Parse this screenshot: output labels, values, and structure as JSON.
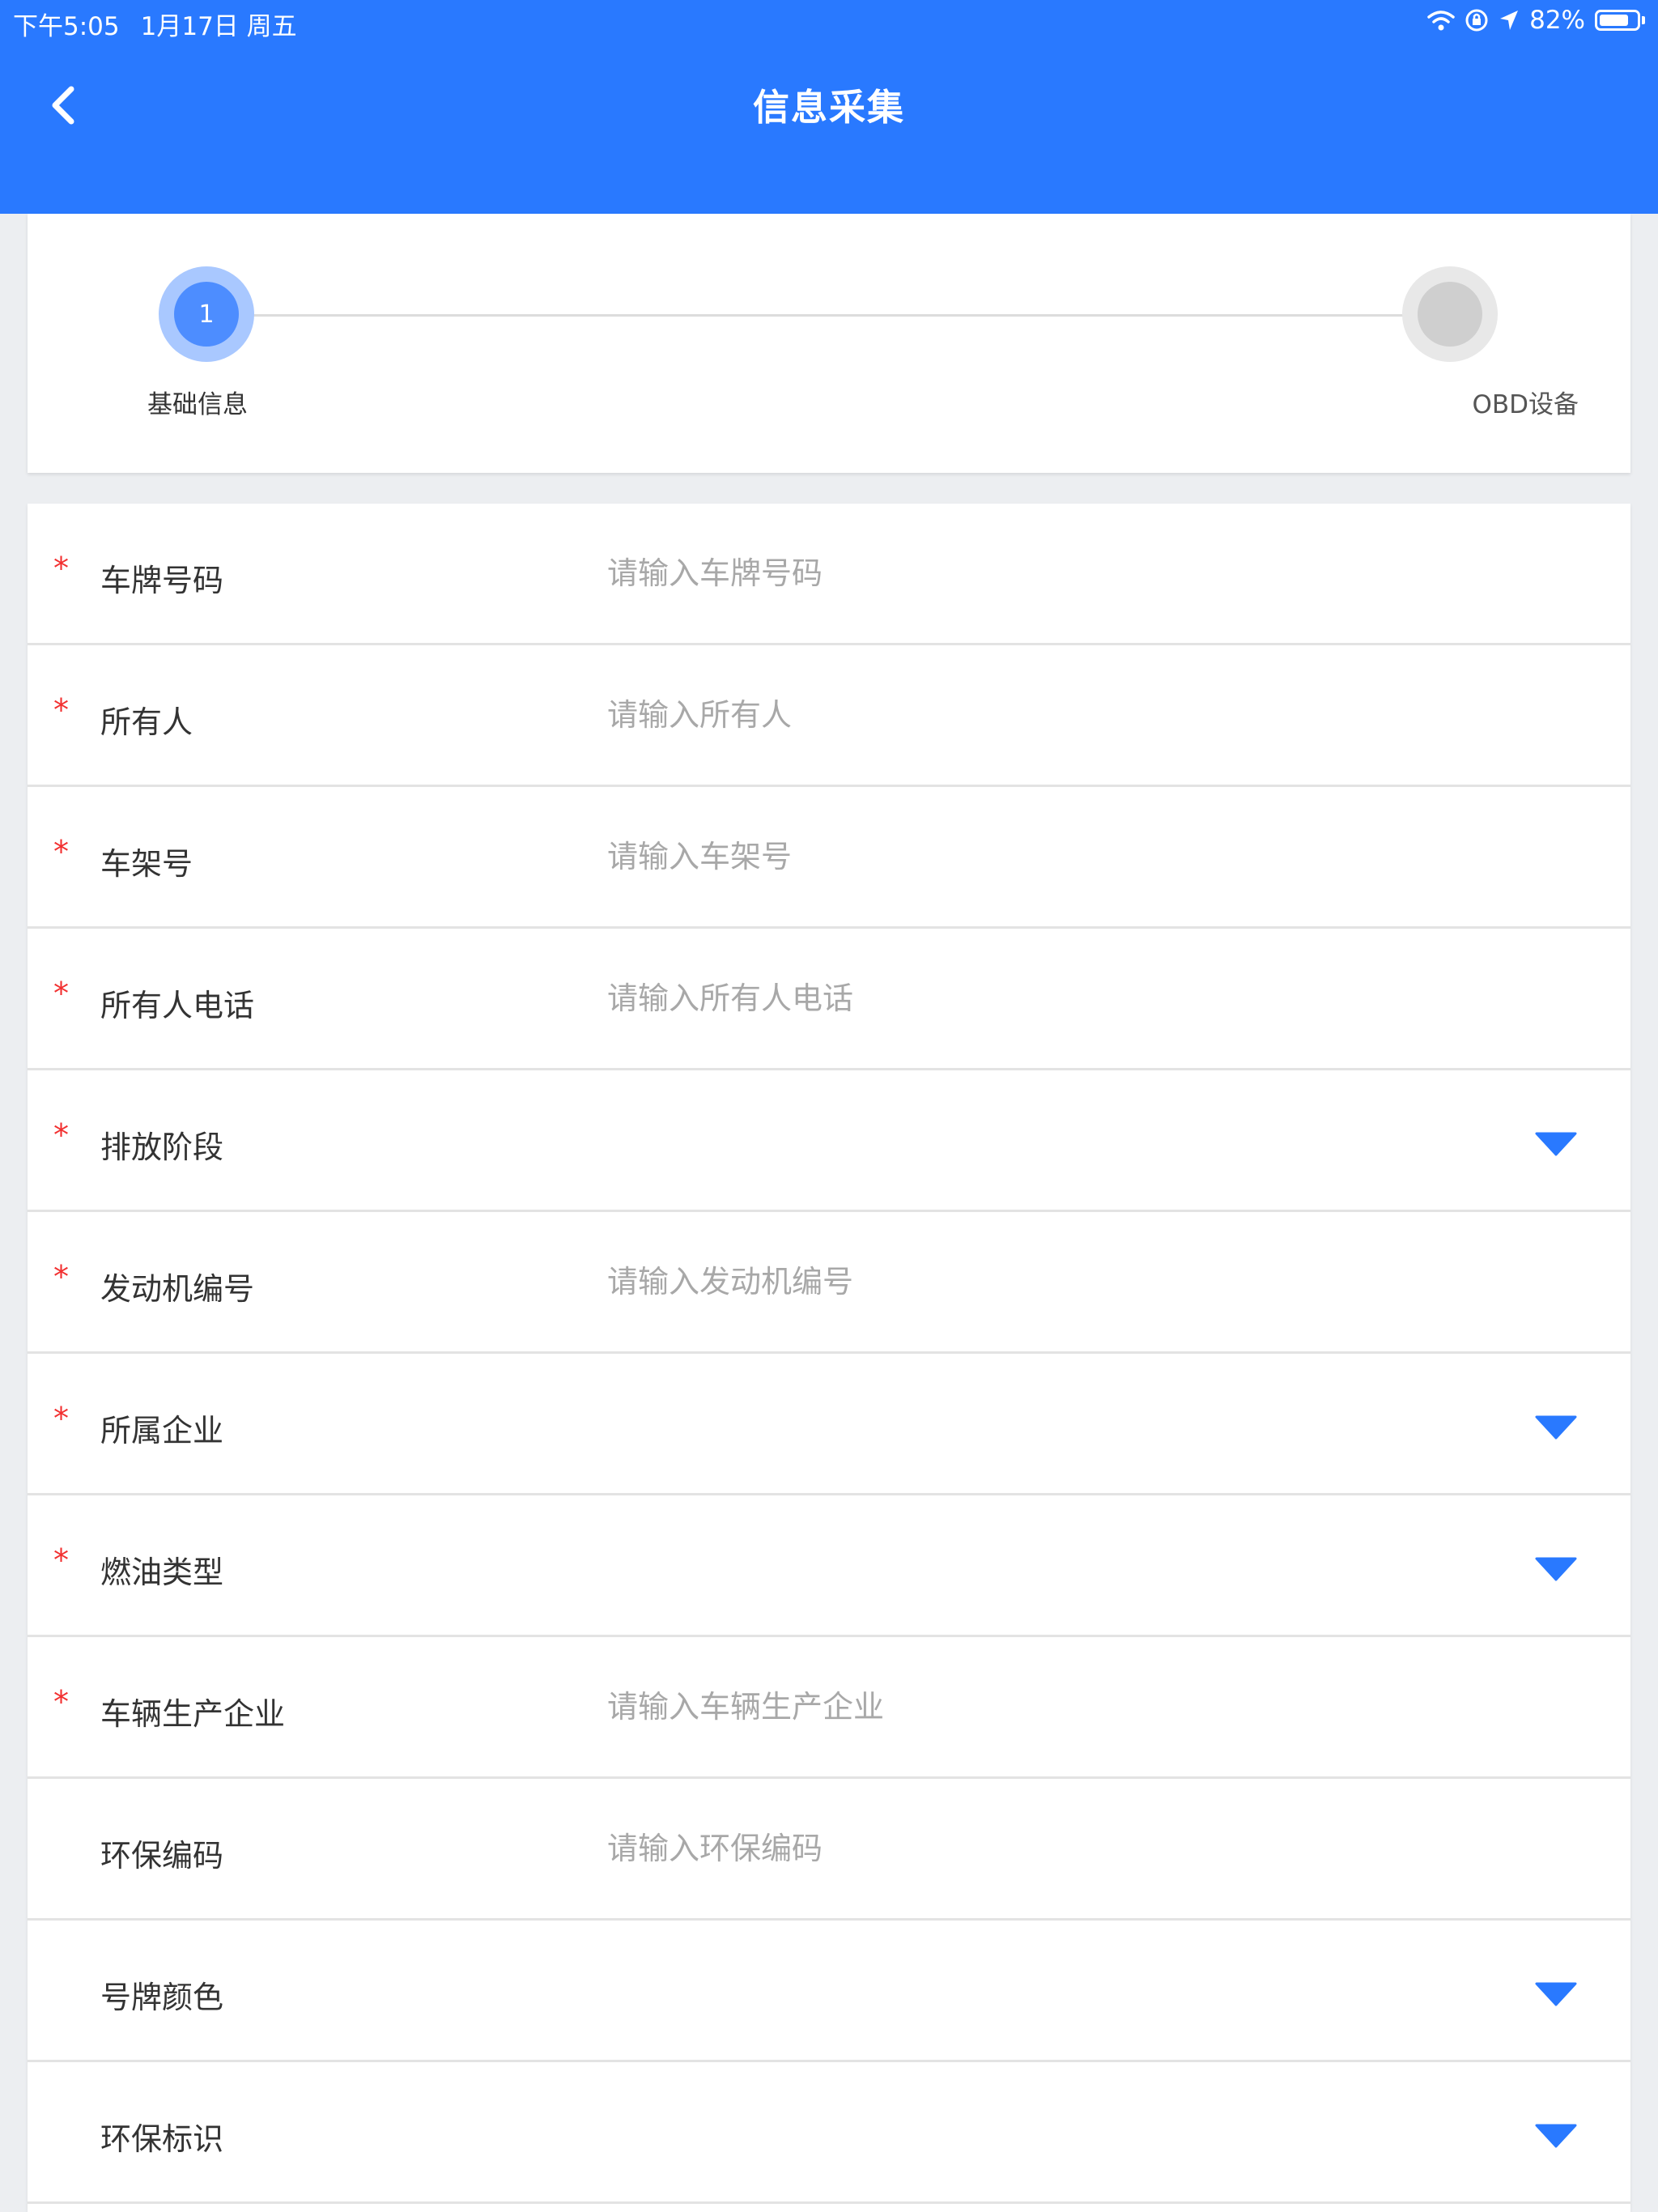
{
  "status_bar": {
    "time": "下午5:05",
    "date": "1月17日 周五",
    "battery": "82%",
    "battery_level": 0.82
  },
  "header": {
    "title": "信息采集"
  },
  "stepper": {
    "steps": [
      {
        "number": "1",
        "label": "基础信息",
        "active": true
      },
      {
        "number": "",
        "label": "OBD设备",
        "active": false
      }
    ]
  },
  "colors": {
    "primary": "#2979ff",
    "required": "#f23030",
    "dropdown_arrow": "#2979ff"
  },
  "form": {
    "fields": [
      {
        "label": "车牌号码",
        "required": true,
        "type": "text",
        "value": "",
        "placeholder": "请输入车牌号码"
      },
      {
        "label": "所有人",
        "required": true,
        "type": "text",
        "value": "",
        "placeholder": "请输入所有人"
      },
      {
        "label": "车架号",
        "required": true,
        "type": "text",
        "value": "",
        "placeholder": "请输入车架号"
      },
      {
        "label": "所有人电话",
        "required": true,
        "type": "text",
        "value": "",
        "placeholder": "请输入所有人电话"
      },
      {
        "label": "排放阶段",
        "required": true,
        "type": "select",
        "value": ""
      },
      {
        "label": "发动机编号",
        "required": true,
        "type": "text",
        "value": "",
        "placeholder": "请输入发动机编号"
      },
      {
        "label": "所属企业",
        "required": true,
        "type": "select",
        "value": ""
      },
      {
        "label": "燃油类型",
        "required": true,
        "type": "select",
        "value": ""
      },
      {
        "label": "车辆生产企业",
        "required": true,
        "type": "text",
        "value": "",
        "placeholder": "请输入车辆生产企业"
      },
      {
        "label": "环保编码",
        "required": false,
        "type": "text",
        "value": "",
        "placeholder": "请输入环保编码"
      },
      {
        "label": "号牌颜色",
        "required": false,
        "type": "select",
        "value": ""
      },
      {
        "label": "环保标识",
        "required": false,
        "type": "select",
        "value": ""
      }
    ]
  }
}
